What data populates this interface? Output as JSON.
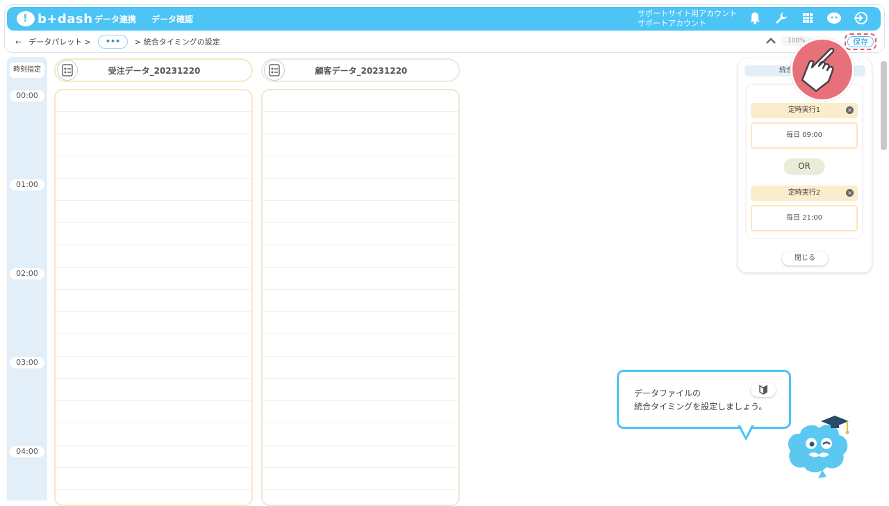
{
  "app": {
    "logo_text": "b+dash",
    "nav": [
      "データ連携",
      "データ確認"
    ],
    "account_line1": "サポートサイト用アカウント",
    "account_line2": "サポートアカウント"
  },
  "breadcrumb": {
    "back": "←",
    "item1": "データパレット  >",
    "dots": "•••",
    "item2": ">  統合タイミングの設定"
  },
  "toolbar": {
    "zoom": "100%",
    "save_label": "保存"
  },
  "timeline": {
    "header": "時刻指定",
    "ticks": [
      "00:00",
      "01:00",
      "02:00",
      "03:00",
      "04:00"
    ]
  },
  "columns": [
    {
      "title": "受注データ_20231220"
    },
    {
      "title": "顧客データ_20231220"
    }
  ],
  "panel": {
    "title": "統合",
    "schedules": [
      {
        "name": "定時実行1",
        "time": "毎日 09:00"
      },
      {
        "name": "定時実行2",
        "time": "毎日 21:00"
      }
    ],
    "or_label": "OR",
    "close_label": "閉じる"
  },
  "guide": {
    "line1": "データファイルの",
    "line2": "統合タイミングを設定しましょう。"
  },
  "colors": {
    "brand": "#4cc4f5",
    "highlight": "#e8707a",
    "col1_border": "#f8e8be",
    "col2_border": "#e8ead2"
  }
}
